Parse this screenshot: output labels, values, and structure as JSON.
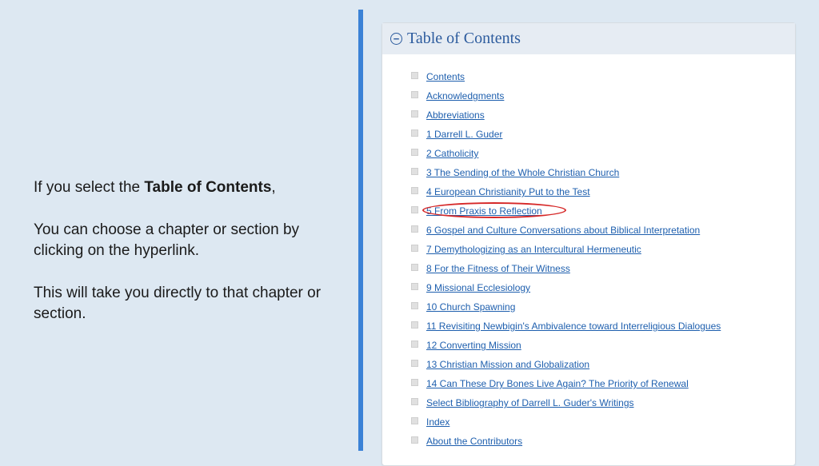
{
  "instruction": {
    "line1_prefix": "If you select the ",
    "line1_bold": "Table of Contents",
    "line1_suffix": ",",
    "para2": "You can choose a chapter or section by clicking on the hyperlink.",
    "para3": "This will take you directly to that chapter or section."
  },
  "toc": {
    "header_title": "Table of Contents",
    "collapse_glyph": "−",
    "items": [
      {
        "label": "Contents",
        "highlighted": false
      },
      {
        "label": "Acknowledgments",
        "highlighted": false
      },
      {
        "label": "Abbreviations",
        "highlighted": false
      },
      {
        "label": "1 Darrell L. Guder",
        "highlighted": false
      },
      {
        "label": "2 Catholicity",
        "highlighted": false
      },
      {
        "label": "3 The Sending of the Whole Christian Church",
        "highlighted": false
      },
      {
        "label": "4 European Christianity Put to the Test",
        "highlighted": false
      },
      {
        "label": "5 From Praxis to Reflection",
        "highlighted": true
      },
      {
        "label": "6 Gospel and Culture Conversations about Biblical Interpretation",
        "highlighted": false
      },
      {
        "label": "7 Demythologizing as an Intercultural Hermeneutic",
        "highlighted": false
      },
      {
        "label": "8 For the Fitness of Their Witness",
        "highlighted": false
      },
      {
        "label": "9 Missional Ecclesiology",
        "highlighted": false
      },
      {
        "label": "10 Church Spawning",
        "highlighted": false
      },
      {
        "label": "11 Revisiting Newbigin's Ambivalence toward Interreligious Dialogues",
        "highlighted": false
      },
      {
        "label": "12 Converting Mission",
        "highlighted": false
      },
      {
        "label": "13 Christian Mission and Globalization",
        "highlighted": false
      },
      {
        "label": "14 Can These Dry Bones Live Again? The Priority of Renewal",
        "highlighted": false
      },
      {
        "label": "Select Bibliography of Darrell L. Guder's Writings",
        "highlighted": false
      },
      {
        "label": "Index",
        "highlighted": false
      },
      {
        "label": "About the Contributors",
        "highlighted": false
      }
    ]
  }
}
